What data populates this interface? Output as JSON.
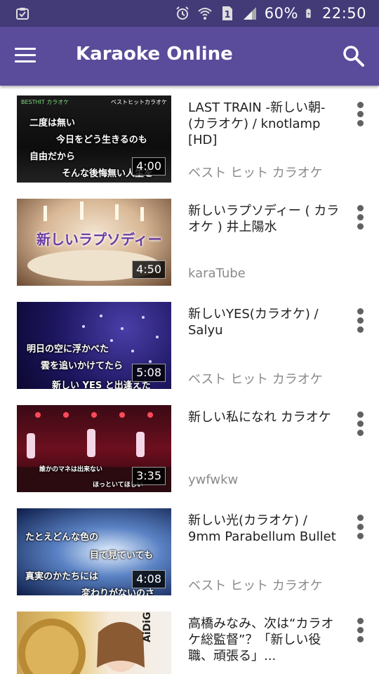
{
  "status_bar": {
    "battery_percent": "60%",
    "time": "22:50",
    "icons": [
      "clipboard-check-icon",
      "alarm-icon",
      "wifi-icon",
      "sim-1-icon",
      "signal-icon",
      "battery-charging-icon"
    ]
  },
  "app_bar": {
    "title": "Karaoke Online",
    "menu_icon": "menu-icon",
    "search_icon": "search-icon"
  },
  "colors": {
    "status_bar": "#433a78",
    "app_bar": "#5a4c9a",
    "title_text": "#212121",
    "channel_text": "#8a8a8a"
  },
  "videos": [
    {
      "title": "LAST TRAIN -新しい朝- (カラオケ) / knotlamp [HD]",
      "channel": "ベスト ヒット カラオケ",
      "duration": "4:00",
      "thumbnail": {
        "top_left_label": "BESTHIT カラオケ",
        "top_right_label": "ベストヒットカラオケ",
        "lyrics": [
          "二度は無い",
          "今日をどう生きるのも",
          "自由だから",
          "そんな後悔無い人生を"
        ]
      }
    },
    {
      "title": "新しいラプソディー ( カラオケ ) 井上陽水",
      "channel": "karaTube",
      "duration": "4:50",
      "thumbnail": {
        "lyrics": [
          "新しいラプソディー"
        ]
      }
    },
    {
      "title": "新しいYES(カラオケ) / Salyu",
      "channel": "ベスト ヒット カラオケ",
      "duration": "5:08",
      "thumbnail": {
        "lyrics": [
          "明日の空に浮かべた",
          "雲を追いかけてたら",
          "新しい YES と出逢えた"
        ]
      }
    },
    {
      "title": "新しい私になれ カラオケ",
      "channel": "ywfwkw",
      "duration": "3:35",
      "thumbnail": {
        "lyrics": [
          "誰かのマネは出来ない",
          "ほっといてほしい"
        ]
      }
    },
    {
      "title": "新しい光(カラオケ) / 9mm Parabellum Bullet",
      "channel": "ベスト ヒット カラオケ",
      "duration": "4:08",
      "thumbnail": {
        "lyrics": [
          "たとえどんな色の",
          "目で見ていても",
          "真実のかたちには",
          "変わりがないのさ"
        ]
      }
    },
    {
      "title": "高橋みなみ、次は“カラオケ総監督”？「新しい役職、頑張る」...",
      "channel": "",
      "duration": "",
      "thumbnail": {
        "side_label": "AiDiGi TV"
      }
    }
  ]
}
